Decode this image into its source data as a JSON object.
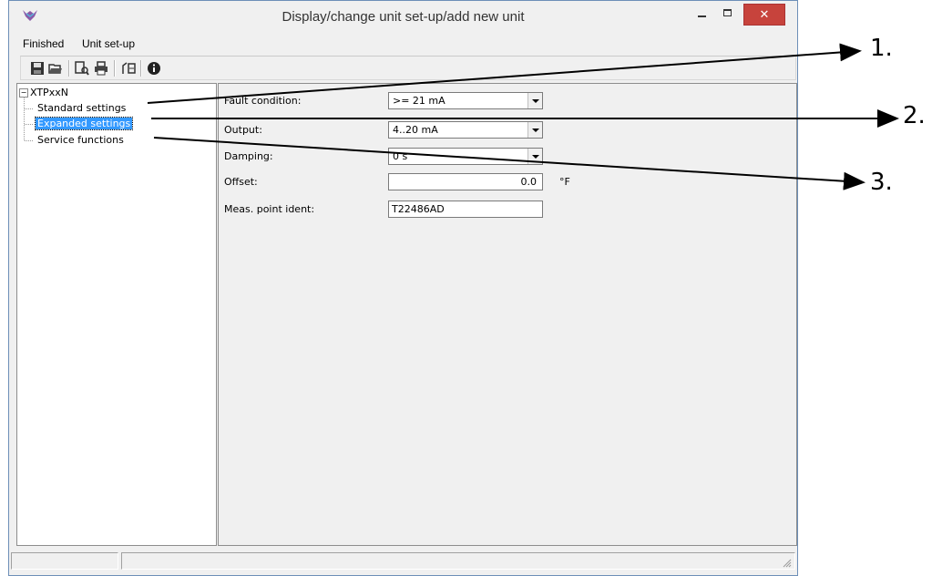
{
  "window": {
    "title": "Display/change unit set-up/add new unit",
    "close_glyph": "✕"
  },
  "menu": {
    "items": [
      "Finished",
      "Unit set-up"
    ]
  },
  "toolbar": {
    "icons": [
      "save-icon",
      "open-folder-icon",
      "find-icon",
      "print-icon",
      "device-config-icon",
      "info-icon"
    ]
  },
  "tree": {
    "root": "XTPxxN",
    "root_toggle": "−",
    "items": [
      {
        "label": "Standard settings",
        "selected": false
      },
      {
        "label": "Expanded settings",
        "selected": true
      },
      {
        "label": "Service functions",
        "selected": false
      }
    ]
  },
  "form": {
    "fields": [
      {
        "label": "Fault condition:",
        "type": "combo",
        "value": ">= 21 mA"
      },
      {
        "label": "Output:",
        "type": "combo",
        "value": "4..20 mA"
      },
      {
        "label": "Damping:",
        "type": "combo",
        "value": "0 s"
      },
      {
        "label": "Offset:",
        "type": "text",
        "value": "0.0",
        "unit": "°F"
      },
      {
        "label": "Meas. point ident:",
        "type": "text",
        "value": "T22486AD"
      }
    ]
  },
  "callouts": [
    "1.",
    "2.",
    "3."
  ],
  "colors": {
    "selection": "#3399ff",
    "close_button": "#c7433c",
    "window_bg": "#f0f0f0"
  }
}
